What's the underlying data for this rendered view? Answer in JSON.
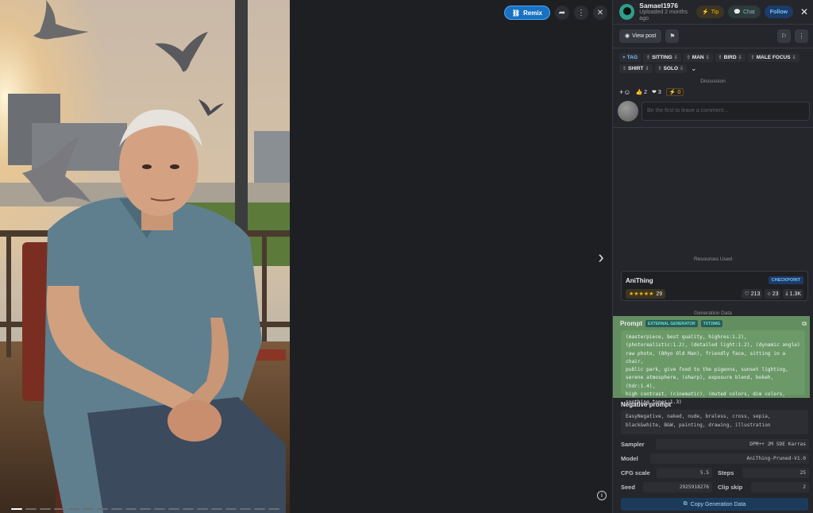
{
  "viewer": {
    "remix_label": "Remix",
    "slide_count": 19,
    "active_slide": 1
  },
  "user": {
    "name": "Samael1976",
    "uploaded": "Uploaded 2 months ago",
    "tip_label": "Tip",
    "chat_label": "Chat",
    "follow_label": "Follow"
  },
  "actions": {
    "view_post_label": "View post"
  },
  "tags": [
    {
      "label": "TAG",
      "is_add": true
    },
    {
      "label": "SITTING"
    },
    {
      "label": "MAN"
    },
    {
      "label": "BIRD"
    },
    {
      "label": "MALE FOCUS"
    },
    {
      "label": "SHIRT"
    },
    {
      "label": "SOLO"
    }
  ],
  "discussion": {
    "title": "Discussion",
    "likes": "2",
    "hearts": "3",
    "buzz": "0",
    "comment_placeholder": "Be the first to leave a comment..."
  },
  "resources": {
    "title": "Resources Used",
    "name": "AniThing",
    "type_badge": "CHECKPOINT",
    "rating_count": "29",
    "likes": "213",
    "comments": "23",
    "downloads": "1.3K"
  },
  "generation": {
    "title": "Generation Data",
    "prompt_label": "Prompt",
    "badge_external": "EXTERNAL GENERATOR",
    "badge_txt2img": "TXT2IMG",
    "prompt_lines": [
      "(masterpiece, best quality, highres:1.2),",
      "(photorealistic:1.2), (detailed light:1.2), (dynamic angle)",
      "raw photo, (80yo Old Man), friendly face, sitting in a chair,",
      "public park, give food to the pigeons, sunset lighting,",
      "serene atmosphere, (sharp), exposure blend, bokeh, (hdr:1.4),",
      "high contrast, (cinematic), (muted colors, dim colors,",
      "soothing tones:1.3)"
    ],
    "negative_label": "Negative prompt",
    "negative_lines": [
      "EasyNegative, naked, nude, braless, cross, sepia,",
      "black&white, B&W, painting, drawing, illustration"
    ],
    "sampler_label": "Sampler",
    "sampler_value": "DPM++ 2M SDE Karras",
    "model_label": "Model",
    "model_value": "AniThing-Pruned-V1.0",
    "cfg_label": "CFG scale",
    "cfg_value": "5.5",
    "steps_label": "Steps",
    "steps_value": "25",
    "seed_label": "Seed",
    "seed_value": "2925918276",
    "clip_label": "Clip skip",
    "clip_value": "2",
    "copy_label": "Copy Generation Data"
  }
}
